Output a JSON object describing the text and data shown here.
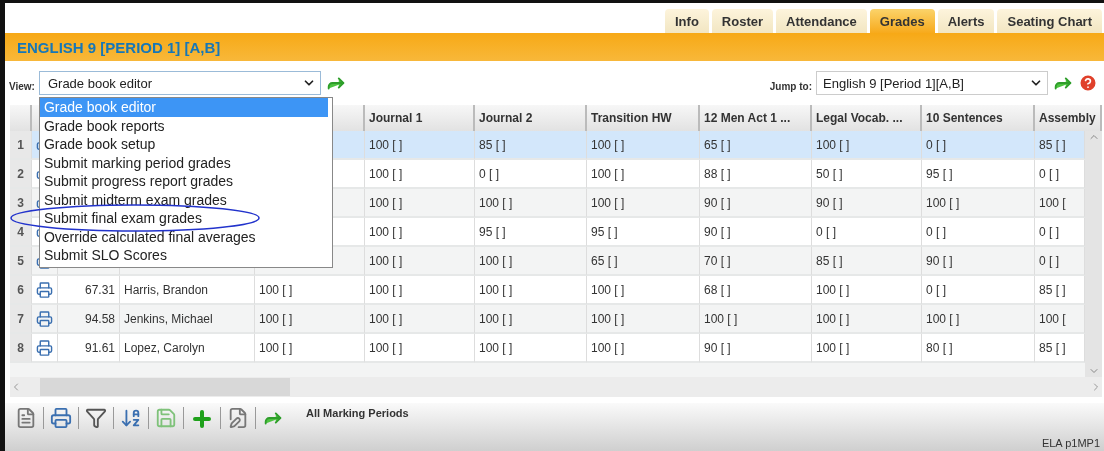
{
  "tabs": [
    {
      "label": "Info",
      "selected": false
    },
    {
      "label": "Roster",
      "selected": false
    },
    {
      "label": "Attendance",
      "selected": false
    },
    {
      "label": "Grades",
      "selected": true
    },
    {
      "label": "Alerts",
      "selected": false
    },
    {
      "label": "Seating Chart",
      "selected": false
    }
  ],
  "title": "ENGLISH 9 [PERIOD 1] [A,B]",
  "view": {
    "label": "View:",
    "value": "Grade book editor",
    "expanded": true,
    "options": [
      {
        "label": "Grade book editor",
        "selected": true,
        "circled": false
      },
      {
        "label": "Grade book reports",
        "selected": false,
        "circled": false
      },
      {
        "label": "Grade book setup",
        "selected": false,
        "circled": false
      },
      {
        "label": "Submit marking period grades",
        "selected": false,
        "circled": false
      },
      {
        "label": "Submit progress report grades",
        "selected": false,
        "circled": false
      },
      {
        "label": "Submit midterm exam grades",
        "selected": false,
        "circled": false
      },
      {
        "label": "Submit final exam grades",
        "selected": false,
        "circled": true
      },
      {
        "label": "Override calculated final averages",
        "selected": false,
        "circled": false
      },
      {
        "label": "Submit SLO Scores",
        "selected": false,
        "circled": false
      }
    ]
  },
  "jump": {
    "label": "Jump to:",
    "value": "English 9 [Period 1][A,B]"
  },
  "table": {
    "columns": [
      "Journal 1",
      "Journal 2",
      "Transition HW",
      "12 Men Act 1 ...",
      "Legal Vocab. ...",
      "10 Sentences",
      "Assembly"
    ],
    "rows": [
      {
        "number": "1",
        "selected": true,
        "grades": [
          "100 [ ]",
          "85 [ ]",
          "100 [ ]",
          "65 [ ]",
          "100 [ ]",
          "0 [ ]",
          "85 [ ]"
        ]
      },
      {
        "number": "2",
        "selected": false,
        "grades": [
          "100 [ ]",
          "0 [ ]",
          "100 [ ]",
          "88 [ ]",
          "50 [ ]",
          "95 [ ]",
          "0 [ ]"
        ]
      },
      {
        "number": "3",
        "selected": false,
        "grades": [
          "100 [ ]",
          "100 [ ]",
          "100 [ ]",
          "90 [ ]",
          "90 [ ]",
          "100 [ ]",
          "100 ["
        ]
      },
      {
        "number": "4",
        "selected": false,
        "grades": [
          "100 [ ]",
          "95 [ ]",
          "95 [ ]",
          "90 [ ]",
          "0 [ ]",
          "0 [ ]",
          "0 [ ]"
        ]
      },
      {
        "number": "5",
        "selected": false,
        "grades": [
          "100 [ ]",
          "100 [ ]",
          "65 [ ]",
          "70 [ ]",
          "85 [ ]",
          "90 [ ]",
          "0 [ ]"
        ]
      },
      {
        "number": "6",
        "selected": false,
        "average": "67.31",
        "name": "Harris, Brandon",
        "grades": [
          "100 [ ]",
          "100 [ ]",
          "100 [ ]",
          "100 [ ]",
          "68 [ ]",
          "100 [ ]",
          "0 [ ]",
          "85 [ ]"
        ]
      },
      {
        "number": "7",
        "selected": false,
        "average": "94.58",
        "name": "Jenkins, Michael",
        "grades": [
          "100 [ ]",
          "100 [ ]",
          "100 [ ]",
          "100 [ ]",
          "100 [ ]",
          "100 [ ]",
          "100 [ ]",
          "100 ["
        ]
      },
      {
        "number": "8",
        "selected": false,
        "average": "91.61",
        "name": "Lopez, Carolyn",
        "grades": [
          "100 [ ]",
          "100 [ ]",
          "100 [ ]",
          "100 [ ]",
          "90 [ ]",
          "100 [ ]",
          "80 [ ]",
          "85 [ ]"
        ]
      }
    ]
  },
  "toolbar": {
    "label": "All Marking Periods"
  },
  "status": "ELA p1MP1"
}
